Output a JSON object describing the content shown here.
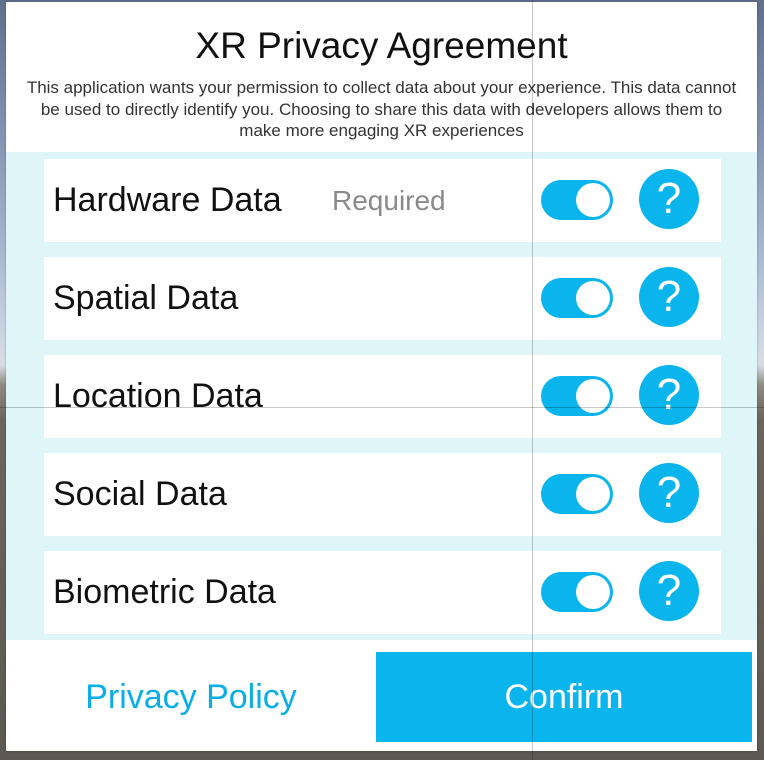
{
  "dialog": {
    "title": "XR Privacy Agreement",
    "description": "This application wants your permission to collect data about your experience. This data cannot be used to directly identify you. Choosing to share this data with developers allows them to make more engaging XR experiences"
  },
  "rows": [
    {
      "label": "Hardware Data",
      "badge": "Required",
      "toggle_on": true,
      "help": "?"
    },
    {
      "label": "Spatial Data",
      "badge": "",
      "toggle_on": true,
      "help": "?"
    },
    {
      "label": "Location Data",
      "badge": "",
      "toggle_on": true,
      "help": "?"
    },
    {
      "label": "Social Data",
      "badge": "",
      "toggle_on": true,
      "help": "?"
    },
    {
      "label": "Biometric Data",
      "badge": "",
      "toggle_on": true,
      "help": "?"
    }
  ],
  "footer": {
    "privacy_policy_label": "Privacy Policy",
    "confirm_label": "Confirm"
  },
  "icons": {
    "help": "question-mark-icon",
    "toggle": "toggle-switch"
  },
  "colors": {
    "accent": "#0ab4ec",
    "list_background": "#dff6f8",
    "required_text": "#8a8a8a"
  }
}
